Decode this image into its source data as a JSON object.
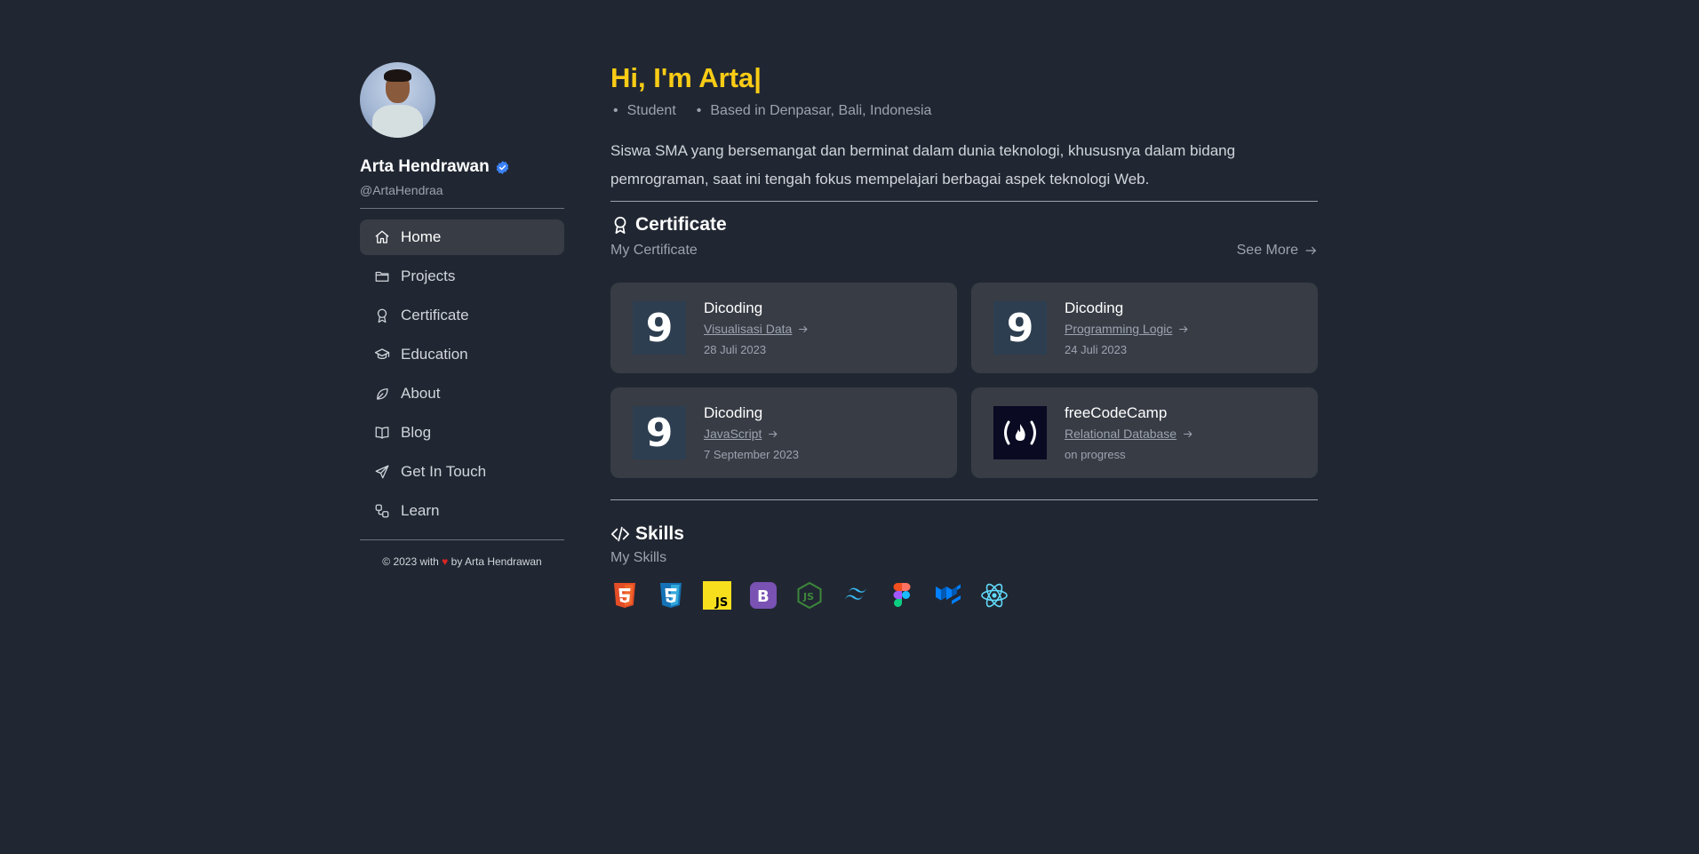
{
  "profile": {
    "name": "Arta Hendrawan",
    "handle": "@ArtaHendraa"
  },
  "nav": [
    {
      "label": "Home",
      "icon": "home-icon",
      "active": true
    },
    {
      "label": "Projects",
      "icon": "folder-icon"
    },
    {
      "label": "Certificate",
      "icon": "award-icon"
    },
    {
      "label": "Education",
      "icon": "graduation-cap-icon"
    },
    {
      "label": "About",
      "icon": "leaf-icon"
    },
    {
      "label": "Blog",
      "icon": "book-icon"
    },
    {
      "label": "Get In Touch",
      "icon": "send-icon"
    },
    {
      "label": "Learn",
      "icon": "workflow-icon"
    }
  ],
  "footer": {
    "prefix": "© 2023 with",
    "suffix": "by Arta Hendrawan"
  },
  "hero": {
    "greeting": "Hi, I'm Arta|",
    "tags": [
      "Student",
      "Based in Denpasar, Bali, Indonesia"
    ],
    "bio": "Siswa SMA yang bersemangat dan berminat dalam dunia teknologi, khususnya dalam bidang pemrograman, saat ini tengah fokus mempelajari berbagai aspek teknologi Web."
  },
  "certificate": {
    "title": "Certificate",
    "subtitle": "My Certificate",
    "see_more": "See More",
    "items": [
      {
        "issuer": "Dicoding",
        "course": "Visualisasi Data",
        "date": "28 Juli 2023",
        "logo": "dicoding"
      },
      {
        "issuer": "Dicoding",
        "course": "Programming Logic",
        "date": "24 Juli 2023",
        "logo": "dicoding"
      },
      {
        "issuer": "Dicoding",
        "course": "JavaScript",
        "date": "7 September 2023",
        "logo": "dicoding"
      },
      {
        "issuer": "freeCodeCamp",
        "course": "Relational Database",
        "date": "on progress",
        "logo": "freecodecamp"
      }
    ]
  },
  "skills": {
    "title": "Skills",
    "subtitle": "My Skills",
    "items": [
      "html5-icon",
      "css3-icon",
      "javascript-icon",
      "bootstrap-icon",
      "nodejs-icon",
      "tailwind-icon",
      "figma-icon",
      "mui-icon",
      "react-icon"
    ]
  },
  "colors": {
    "background": "#212732",
    "accent": "#facc15",
    "card": "#383c45"
  }
}
